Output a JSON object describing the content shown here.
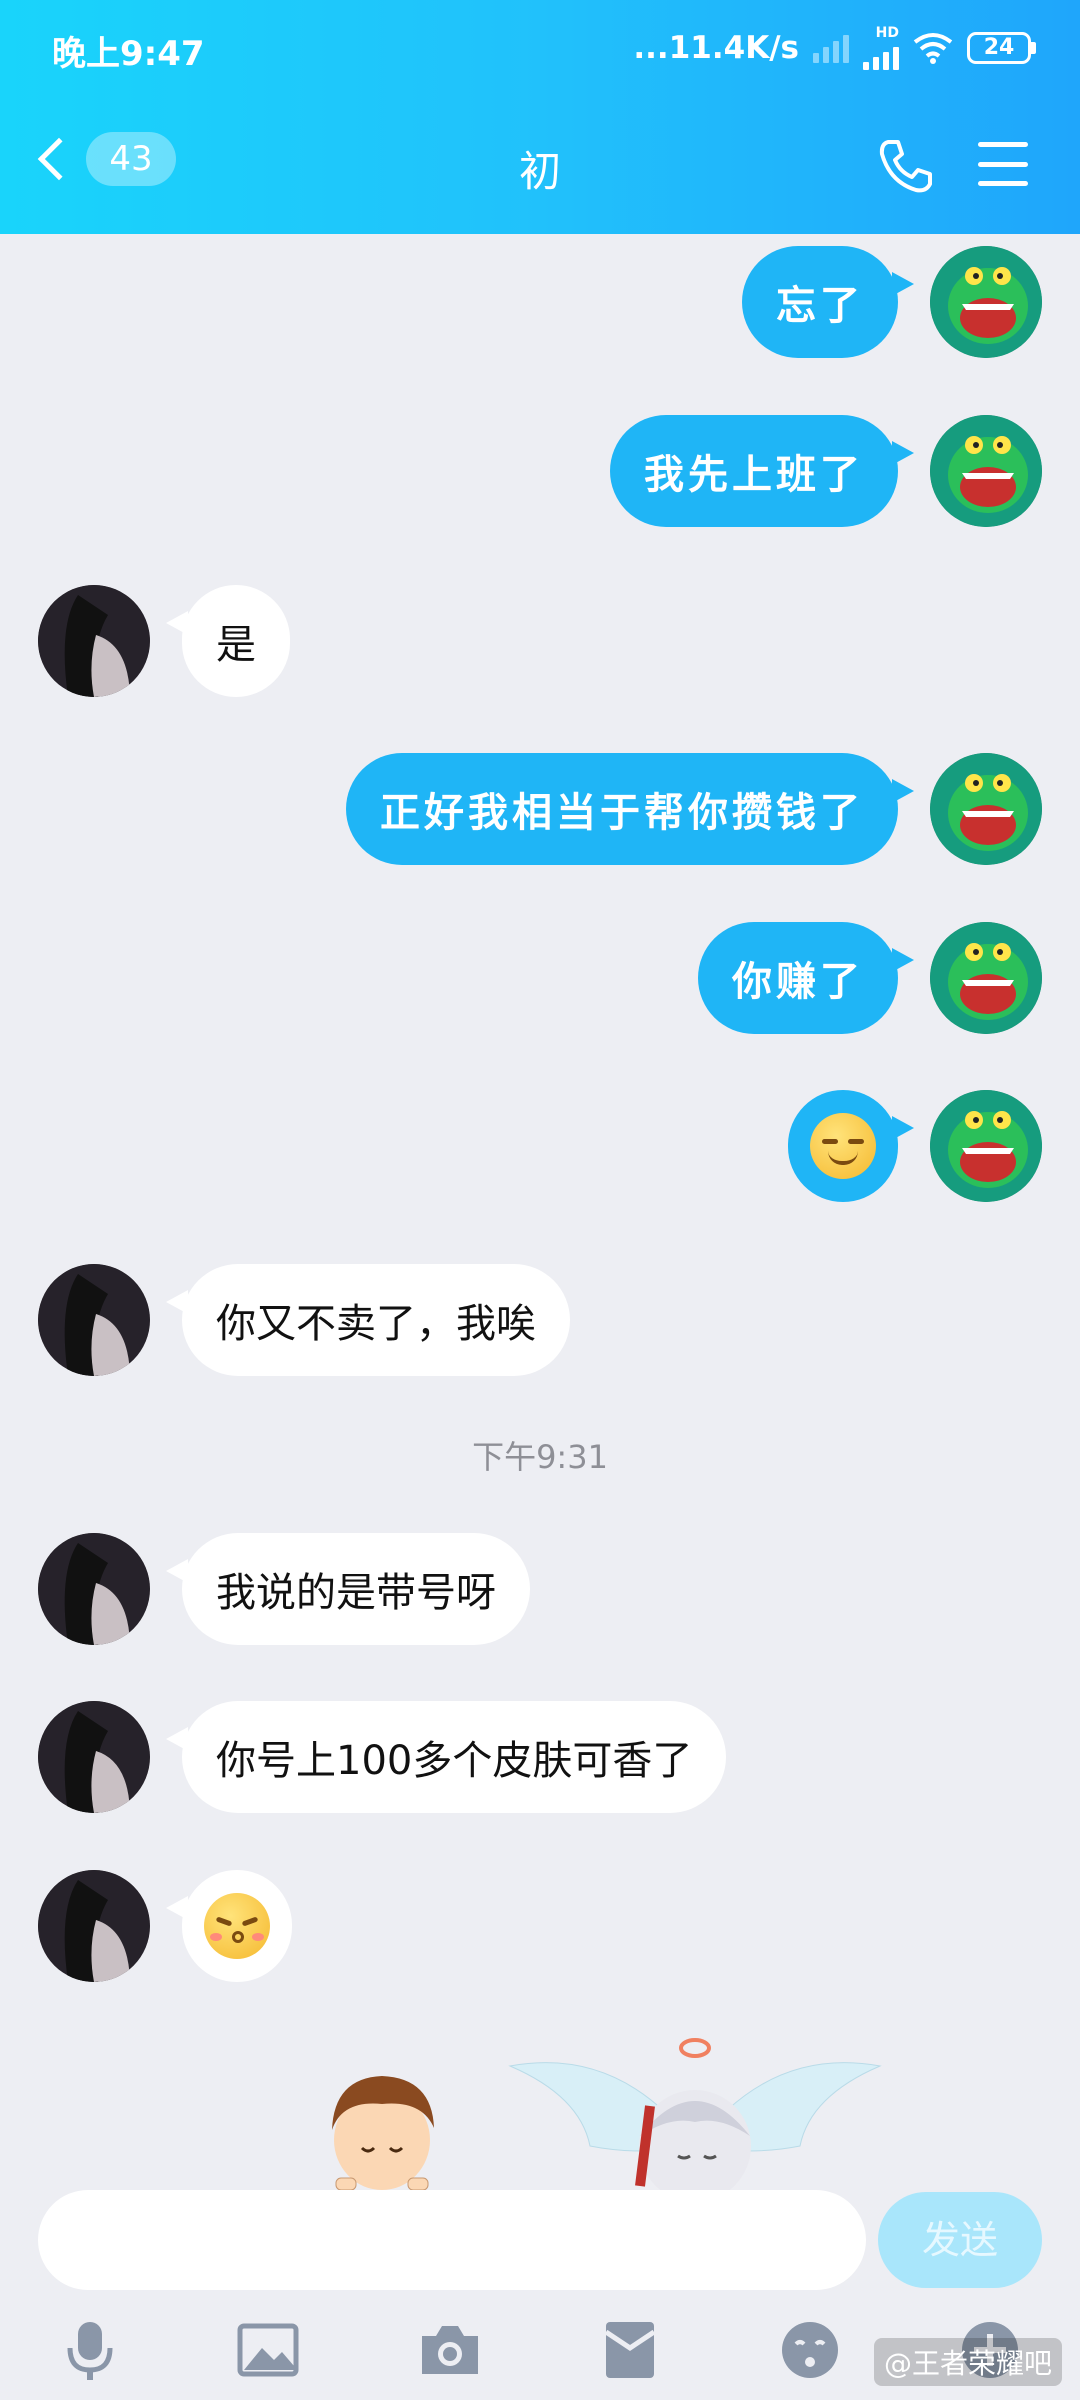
{
  "status_bar": {
    "time": "晚上9:47",
    "network_speed": "...11.4K/s",
    "hd_label": "HD",
    "battery": "24"
  },
  "header": {
    "unread_count": "43",
    "title": "初",
    "icons": [
      "chevron-left-icon",
      "phone-icon",
      "menu-icon"
    ]
  },
  "messages": [
    {
      "side": "mine",
      "text": "忘了"
    },
    {
      "side": "mine",
      "text": "我先上班了"
    },
    {
      "side": "other",
      "text": "是"
    },
    {
      "side": "mine",
      "text": "正好我相当于帮你攒钱了"
    },
    {
      "side": "mine",
      "text": "你赚了"
    },
    {
      "side": "mine",
      "emoji": "smirk-emoji"
    },
    {
      "side": "other",
      "text": "你又不卖了，我唉"
    },
    {
      "side": "other",
      "text": "我说的是带号呀"
    },
    {
      "side": "other",
      "text": "你号上100多个皮肤可香了"
    },
    {
      "side": "other",
      "emoji": "kiss-emoji"
    }
  ],
  "timestamp": "下午9:31",
  "input": {
    "placeholder": "",
    "send_label": "发送"
  },
  "toolbar": {
    "icons": [
      "microphone-icon",
      "image-icon",
      "camera-icon",
      "red-packet-icon",
      "emoji-icon",
      "plus-icon"
    ]
  },
  "watermark": "@王者荣耀吧",
  "colors": {
    "header_start": "#19d4fb",
    "header_end": "#1fa6fb",
    "my_bubble": "#1fb5f6",
    "other_bubble": "#ffffff",
    "background": "#edeef3",
    "send_button": "#a9e6fb"
  }
}
